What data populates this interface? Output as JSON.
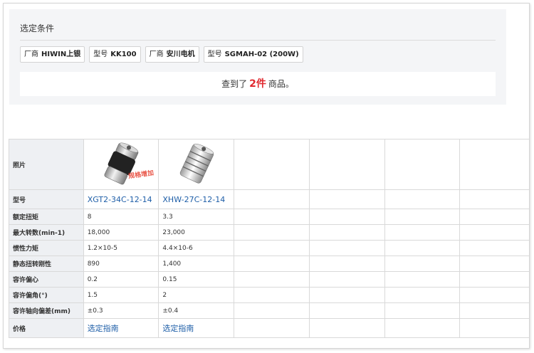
{
  "conditions": {
    "title": "选定条件",
    "chips": [
      {
        "key": "厂商",
        "value": "HIWIN上银"
      },
      {
        "key": "型号",
        "value": "KK100"
      },
      {
        "key": "厂商",
        "value": "安川电机"
      },
      {
        "key": "型号",
        "value": "SGMAH-02 (200W)"
      }
    ],
    "result_prefix": "查到了",
    "result_count": "2件",
    "result_suffix": "商品。"
  },
  "table": {
    "labels": {
      "photo": "照片",
      "model": "型号",
      "rated_torque": "额定扭矩",
      "max_speed": "最大转数(min-1)",
      "inertia": "惯性力矩",
      "torsional_stiffness": "静态扭转刚性",
      "parallel_misalignment": "容许偏心",
      "angular_misalignment": "容许偏角(°)",
      "axial_misalignment": "容许轴向偏差(mm)",
      "price": "价格"
    },
    "products": [
      {
        "image_icon": "jaw-coupling-image",
        "overlay": "规格增加",
        "model": "XGT2-34C-12-14",
        "rated_torque": "8",
        "max_speed": "18,000",
        "inertia": "1.2×10-5",
        "torsional_stiffness": "890",
        "parallel_misalignment": "0.2",
        "angular_misalignment": "1.5",
        "axial_misalignment": "±0.3",
        "price": "选定指南"
      },
      {
        "image_icon": "slit-coupling-image",
        "overlay": "",
        "model": "XHW-27C-12-14",
        "rated_torque": "3.3",
        "max_speed": "23,000",
        "inertia": "4.4×10-6",
        "torsional_stiffness": "1,400",
        "parallel_misalignment": "0.15",
        "angular_misalignment": "2",
        "axial_misalignment": "±0.4",
        "price": "选定指南"
      }
    ]
  },
  "colors": {
    "accent": "#e0282e",
    "link": "#1f5fa8",
    "label_bg": "#eef0f3"
  }
}
